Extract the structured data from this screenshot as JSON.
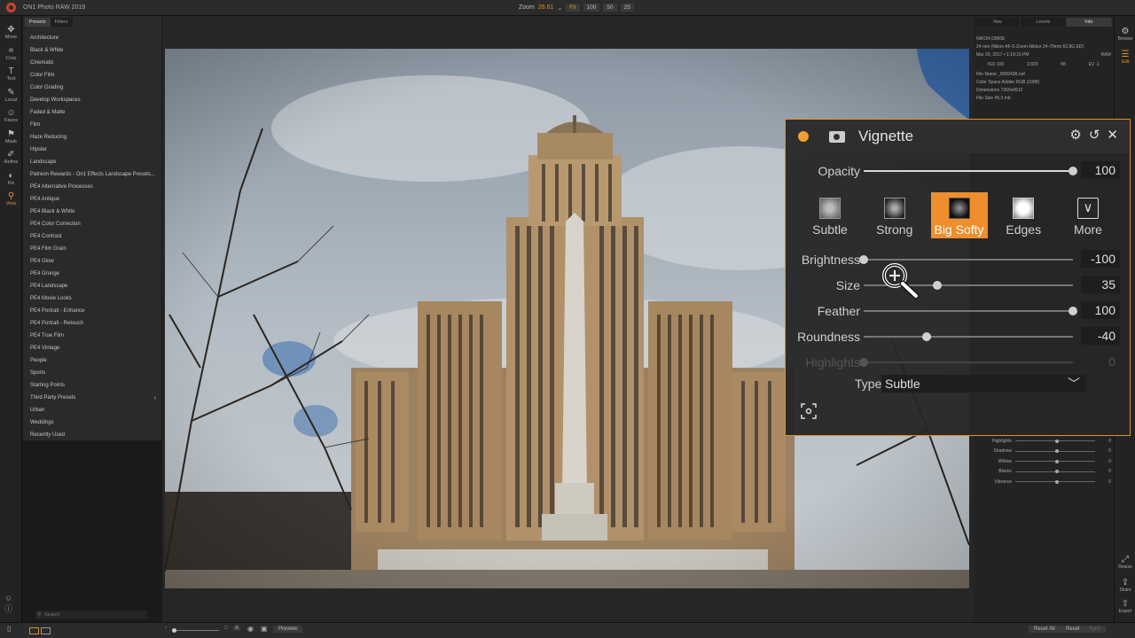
{
  "app": {
    "title": "ON1 Photo RAW 2019"
  },
  "zoom": {
    "label": "Zoom",
    "value": "26.61",
    "caret": "⌄",
    "buttons": [
      "Fit",
      "100",
      "50",
      "25"
    ]
  },
  "left_tools": [
    {
      "icon": "✥",
      "label": "Move"
    },
    {
      "icon": "⌗",
      "label": "Crop"
    },
    {
      "icon": "T",
      "label": "Text"
    },
    {
      "icon": "✎",
      "label": "Local"
    },
    {
      "icon": "☺",
      "label": "Faces"
    },
    {
      "icon": "⚑",
      "label": "Mask"
    },
    {
      "icon": "✐",
      "label": "Refine"
    },
    {
      "icon": "◐",
      "label": "Fix"
    },
    {
      "icon": "⚲",
      "label": "View"
    }
  ],
  "presets_panel": {
    "tabs": [
      "Presets",
      "Filters"
    ],
    "items": [
      "Architecture",
      "Black & White",
      "Cinematic",
      "Color Film",
      "Color Grading",
      "Develop Workspaces",
      "Faded & Matte",
      "Film",
      "Haze Reducing",
      "Hipster",
      "Landscape",
      "Patreon Rewards - On1 Effects Landscape Presets...",
      "PE4 Alternative Processes",
      "PE4 Antique",
      "PE4 Black & White",
      "PE4 Color Correction",
      "PE4 Contrast",
      "PE4 Film Grain",
      "PE4 Glow",
      "PE4 Grunge",
      "PE4 Landscape",
      "PE4 Movie Looks",
      "PE4 Portrait - Enhance",
      "PE4 Portrait - Retouch",
      "PE4 True Film",
      "PE4 Vintage",
      "People",
      "Sports",
      "Starting Points",
      "Third Party Presets",
      "Urban",
      "Weddings",
      "Recently Used"
    ],
    "expandable_item": "Third Party Presets",
    "search_placeholder": "Search"
  },
  "right_panel": {
    "tabs": [
      "Nav",
      "Levels",
      "Info"
    ],
    "info": {
      "camera": "NIKON D800E",
      "lens": "24 mm (Nikon AF-S Zoom-Nikkor 24-70mm f/2.8G ED)",
      "date": "Mar 29, 2017 • 1:19:15 PM",
      "format": "RAW",
      "exif": [
        "ISO 100",
        "1/320",
        "f/8",
        "EV -1"
      ],
      "file_name": "File Name _8009438.nef",
      "color_space": "Color Space Adobe RGB (1998)",
      "dimensions": "Dimensions 7360x4912",
      "file_size": "File Size 45.3 mb"
    },
    "tone_sliders": [
      {
        "label": "Highlights",
        "value": "0",
        "pos": 0.5
      },
      {
        "label": "Shadows",
        "value": "0",
        "pos": 0.5
      },
      {
        "label": "Whites",
        "value": "0",
        "pos": 0.5
      },
      {
        "label": "Blacks",
        "value": "0",
        "pos": 0.5
      },
      {
        "label": "Vibrance",
        "value": "0",
        "pos": 0.5
      }
    ]
  },
  "far_right": [
    {
      "icon": "⚙",
      "label": "Browse"
    },
    {
      "icon": "☰",
      "label": "Edit"
    },
    {
      "icon": "⤢",
      "label": "Resize"
    },
    {
      "icon": "⇪",
      "label": "Share"
    },
    {
      "icon": "⇧",
      "label": "Export"
    }
  ],
  "bottom_bar": {
    "preview": "Preview",
    "reset_all": "Reset All",
    "reset": "Reset",
    "sync": "Sync",
    "frame_icons": [
      "□",
      "A"
    ]
  },
  "vignette": {
    "title": "Vignette",
    "opacity": {
      "label": "Opacity",
      "value": "100",
      "fraction": 1.0
    },
    "presets": [
      "Subtle",
      "Strong",
      "Big Softy",
      "Edges",
      "More"
    ],
    "active_preset": "Big Softy",
    "sliders": [
      {
        "label": "Brightness",
        "value": "-100",
        "fraction": 0.0
      },
      {
        "label": "Size",
        "value": "35",
        "fraction": 0.35
      },
      {
        "label": "Feather",
        "value": "100",
        "fraction": 1.0
      },
      {
        "label": "Roundness",
        "value": "-40",
        "fraction": 0.3
      },
      {
        "label": "Highlights",
        "value": "0",
        "fraction": 0.0,
        "disabled": true
      }
    ],
    "type": {
      "label": "Type",
      "value": "Subtle"
    },
    "accent": "#ee8e2c"
  }
}
